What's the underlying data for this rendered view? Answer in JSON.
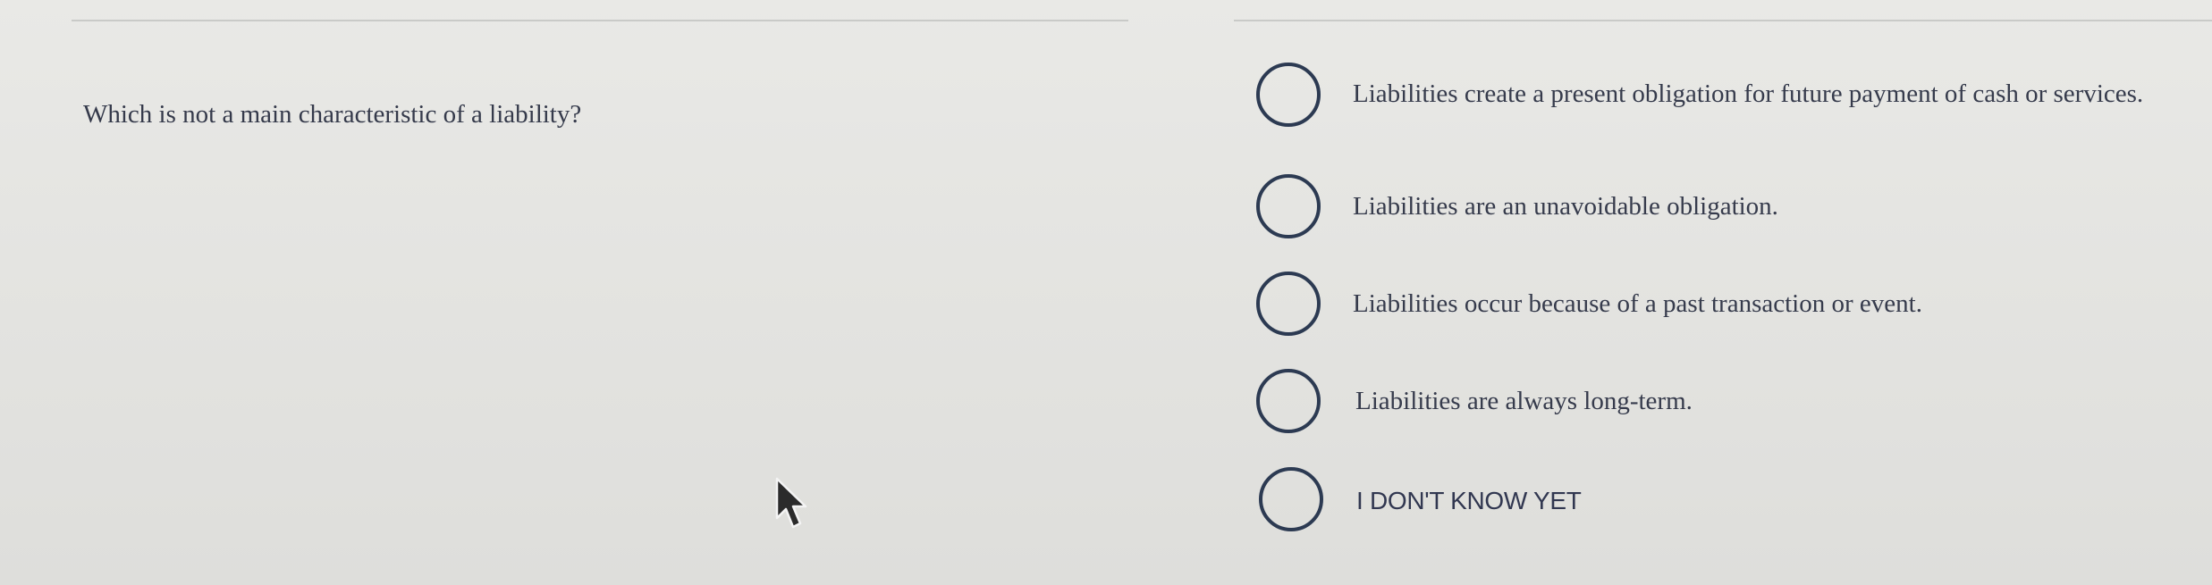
{
  "question": {
    "text": "Which is not a main characteristic of a liability?"
  },
  "options": [
    {
      "label": "Liabilities create a present obligation for future payment of cash or services.",
      "selected": false
    },
    {
      "label": "Liabilities are an unavoidable obligation.",
      "selected": false
    },
    {
      "label": "Liabilities occur because of a past transaction or event.",
      "selected": false
    },
    {
      "label": "Liabilities are always long-term.",
      "selected": false
    },
    {
      "label": "I DON'T KNOW YET",
      "selected": false
    }
  ],
  "icons": {
    "radio": "radio-unselected-icon",
    "cursor": "mouse-pointer-icon"
  },
  "colors": {
    "radio_border": "#2c3a52",
    "text": "#353a4b",
    "background": "#e6e6e3"
  }
}
